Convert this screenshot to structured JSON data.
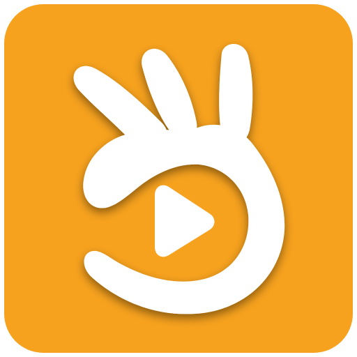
{
  "app_icon": {
    "icon": "ok-hand-play-icon",
    "background_color": "#F7A21E",
    "foreground_color": "#FFFFFF",
    "shadow_color": "#C4700A"
  }
}
